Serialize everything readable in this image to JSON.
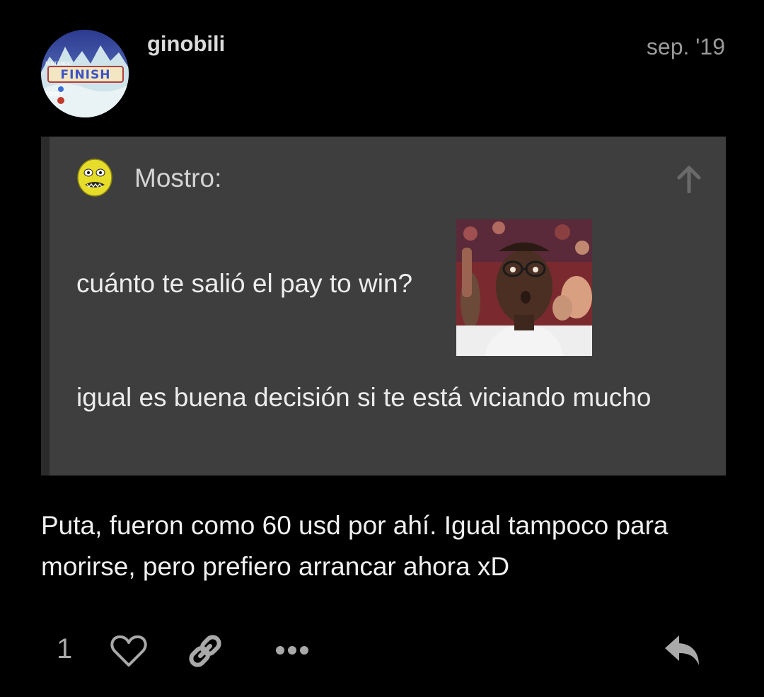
{
  "post": {
    "username": "ginobili",
    "date": "sep. '19",
    "avatar_text": {
      "brand_top": "NINTENDO",
      "word": "FINISH",
      "brand_bottom": "SONY"
    },
    "quote": {
      "author": "Mostro:",
      "line1": "cuánto te salió el pay to win?",
      "line2": "igual es buena decisión si te está viciando mucho"
    },
    "body": "Puta, fueron como 60 usd por ahí. Igual tampoco para morirse, pero prefiero arrancar ahora xD"
  },
  "actions": {
    "likes_count": "1",
    "icons": [
      "heart-icon",
      "link-icon",
      "more-icon",
      "reply-icon"
    ]
  },
  "colors": {
    "background": "#000000",
    "quote_background": "#3e3e3e",
    "muted_text": "#9a9a9a"
  }
}
